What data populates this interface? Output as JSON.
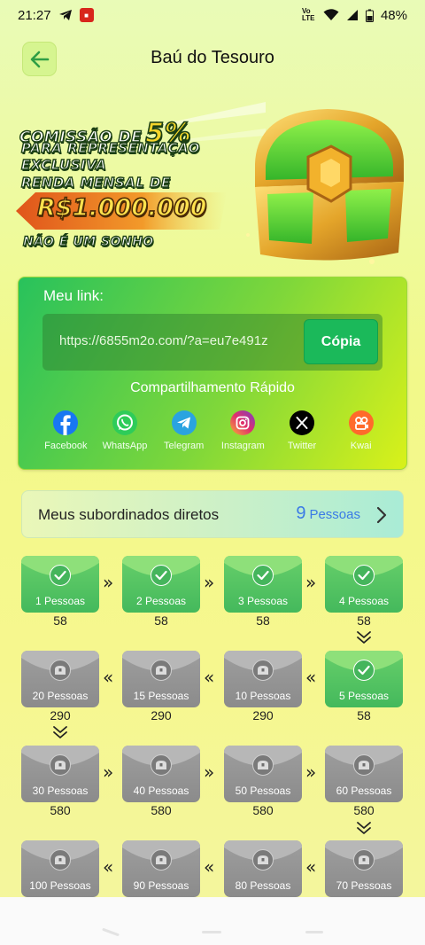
{
  "status_bar": {
    "time": "21:27",
    "volte": "Vo LTE",
    "battery": "48%"
  },
  "header": {
    "title": "Baú do Tesouro"
  },
  "banner": {
    "line1": "COMISSÃO DE",
    "percent": "5%",
    "line2": "PARA REPRESENTAÇÃO",
    "line3": "EXCLUSIVA",
    "line4": "RENDA MENSAL DE",
    "amount": "R$1.000.000",
    "line6": "NÃO É UM SONHO"
  },
  "link_card": {
    "label": "Meu link:",
    "url": "https://6855m2o.com/?a=eu7e491z",
    "copy_label": "Cópia",
    "share_title": "Compartilhamento Rápido",
    "share_items": [
      {
        "name": "Facebook",
        "icon": "facebook-icon",
        "color": "#1877f2"
      },
      {
        "name": "WhatsApp",
        "icon": "whatsapp-icon",
        "color": "#2ecc59"
      },
      {
        "name": "Telegram",
        "icon": "telegram-icon",
        "color": "#2aa3e0"
      },
      {
        "name": "Instagram",
        "icon": "instagram-icon",
        "color": "#d6287c"
      },
      {
        "name": "Twitter",
        "icon": "x-icon",
        "color": "#000000"
      },
      {
        "name": "Kwai",
        "icon": "kwai-icon",
        "color": "#ff6a2b"
      }
    ]
  },
  "subordinates": {
    "label": "Meus subordinados diretos",
    "count": "9",
    "unit": "Pessoas"
  },
  "rewards": [
    {
      "label": "1 Pessoas",
      "amount": "58",
      "status": "completed"
    },
    {
      "label": "2 Pessoas",
      "amount": "58",
      "status": "completed"
    },
    {
      "label": "3 Pessoas",
      "amount": "58",
      "status": "completed"
    },
    {
      "label": "4 Pessoas",
      "amount": "58",
      "status": "completed"
    },
    {
      "label": "5 Pessoas",
      "amount": "58",
      "status": "completed"
    },
    {
      "label": "10 Pessoas",
      "amount": "290",
      "status": "locked"
    },
    {
      "label": "15 Pessoas",
      "amount": "290",
      "status": "locked"
    },
    {
      "label": "20 Pessoas",
      "amount": "290",
      "status": "locked"
    },
    {
      "label": "30 Pessoas",
      "amount": "580",
      "status": "locked"
    },
    {
      "label": "40 Pessoas",
      "amount": "580",
      "status": "locked"
    },
    {
      "label": "50 Pessoas",
      "amount": "580",
      "status": "locked"
    },
    {
      "label": "60 Pessoas",
      "amount": "580",
      "status": "locked"
    },
    {
      "label": "70 Pessoas",
      "amount": "",
      "status": "locked"
    },
    {
      "label": "80 Pessoas",
      "amount": "",
      "status": "locked"
    },
    {
      "label": "90 Pessoas",
      "amount": "",
      "status": "locked"
    },
    {
      "label": "100 Pessoas",
      "amount": "",
      "status": "locked"
    }
  ],
  "colors": {
    "accent_green": "#1bb95a",
    "count_blue": "#3a7ae6",
    "locked_gray": "#9e9e9e"
  }
}
